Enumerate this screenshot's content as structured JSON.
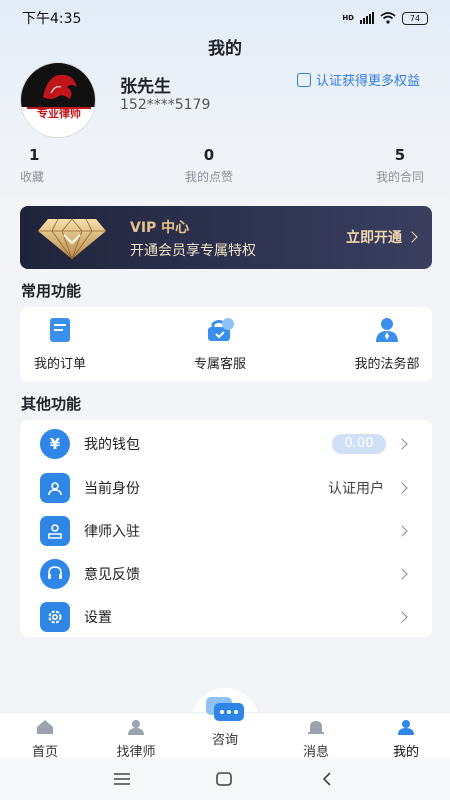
{
  "status": {
    "time": "下午4:35",
    "battery": "74"
  },
  "page_title": "我的",
  "profile": {
    "name": "张先生",
    "phone": "152****5179",
    "avatar_text": "专业律师",
    "verify_link": "认证获得更多权益"
  },
  "stats": [
    {
      "value": "1",
      "label": "收藏"
    },
    {
      "value": "0",
      "label": "我的点赞"
    },
    {
      "value": "5",
      "label": "我的合同"
    }
  ],
  "vip": {
    "title": "VIP 中心",
    "subtitle": "开通会员享专属特权",
    "button": "立即开通"
  },
  "common": {
    "title": "常用功能",
    "items": [
      {
        "label": "我的订单",
        "icon": "order-icon"
      },
      {
        "label": "专属客服",
        "icon": "service-icon"
      },
      {
        "label": "我的法务部",
        "icon": "legal-dept-icon"
      }
    ]
  },
  "other": {
    "title": "其他功能",
    "rows": [
      {
        "label": "我的钱包",
        "value": "0.00",
        "icon": "wallet-icon"
      },
      {
        "label": "当前身份",
        "value": "认证用户",
        "icon": "identity-icon"
      },
      {
        "label": "律师入驻",
        "value": "",
        "icon": "lawyer-join-icon"
      },
      {
        "label": "意见反馈",
        "value": "",
        "icon": "feedback-icon"
      },
      {
        "label": "设置",
        "value": "",
        "icon": "settings-icon"
      }
    ]
  },
  "tabbar": {
    "items": [
      {
        "label": "首页",
        "icon": "home-icon"
      },
      {
        "label": "找律师",
        "icon": "find-lawyer-icon"
      },
      {
        "label": "咨询",
        "icon": "chat-icon"
      },
      {
        "label": "消息",
        "icon": "bell-icon"
      },
      {
        "label": "我的",
        "icon": "person-icon"
      }
    ],
    "active": "我的"
  },
  "colors": {
    "accent": "#2f86e6",
    "vip_gold": "#e6c28f",
    "vip_bg": "#2a2e48"
  }
}
